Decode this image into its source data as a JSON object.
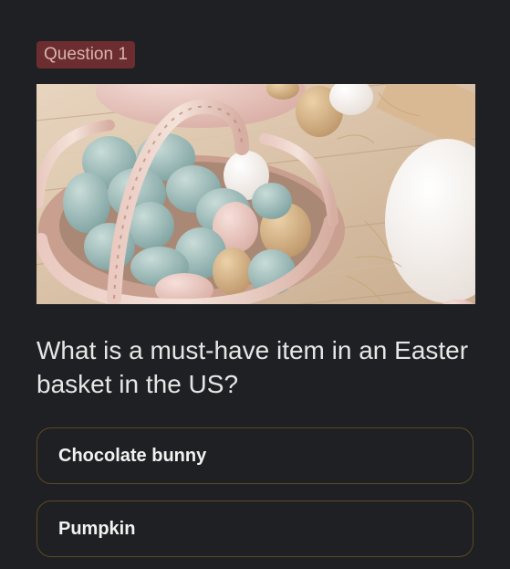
{
  "question_badge": "Question 1",
  "image": {
    "subject": "easter-eggs-basket-photo"
  },
  "question_text": "What is a must-have item in an Easter basket in the US?",
  "options": [
    {
      "label": "Chocolate bunny"
    },
    {
      "label": "Pumpkin"
    }
  ],
  "colors": {
    "background": "#1f2023",
    "badge_bg": "#6b2d2f",
    "badge_text": "#d9b3b0",
    "option_border": "#5c4a22",
    "question_text": "#e6e6e6"
  }
}
